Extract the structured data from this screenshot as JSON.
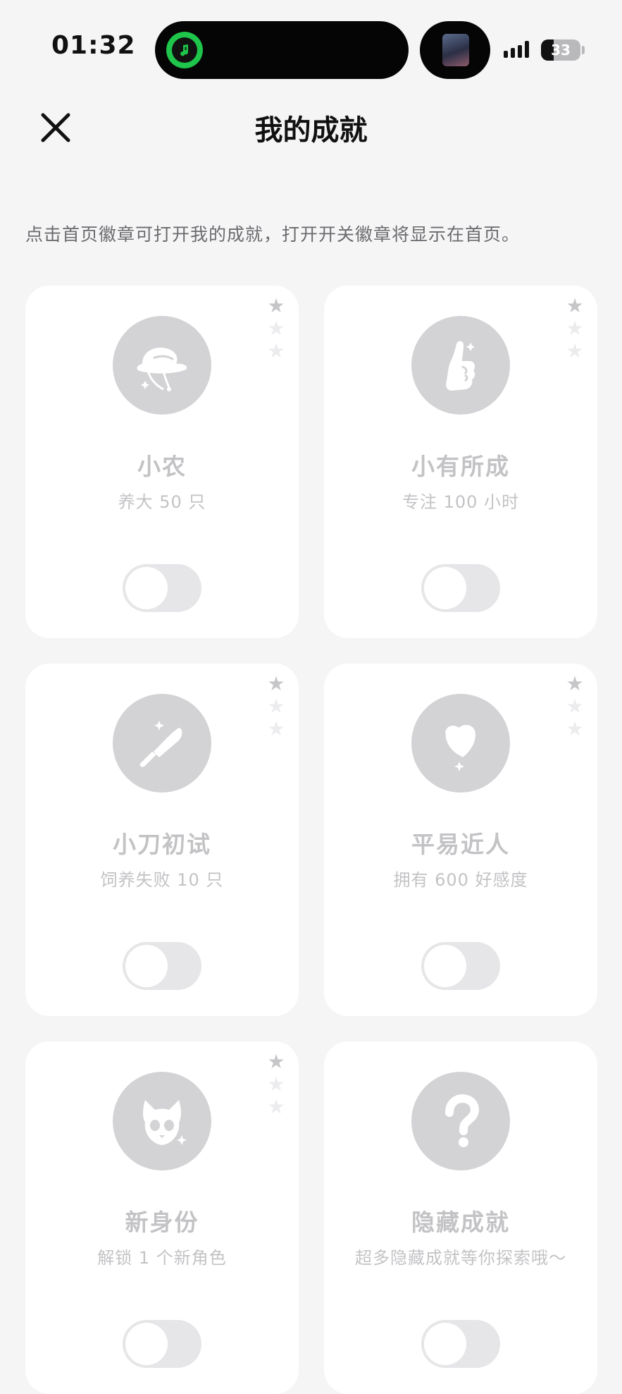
{
  "status_bar": {
    "time": "01:32",
    "battery": "33",
    "battery_level": 0.33
  },
  "header": {
    "title": "我的成就",
    "close_icon": "close-icon"
  },
  "intro": "点击首页徽章可打开我的成就，打开开关徽章将显示在首页。",
  "colors": {
    "background": "#f5f5f6",
    "card": "#ffffff",
    "badge": "#d3d3d5",
    "muted_text": "#c3c3c6",
    "toggle_off": "#e6e6e8"
  },
  "achievements": [
    {
      "title": "小农",
      "desc": "养大 50 只",
      "icon": "farmer-hat-icon",
      "stars_filled": 1,
      "stars_total": 3,
      "enabled": false
    },
    {
      "title": "小有所成",
      "desc": "专注 100 小时",
      "icon": "thumbs-up-icon",
      "stars_filled": 1,
      "stars_total": 3,
      "enabled": false
    },
    {
      "title": "小刀初试",
      "desc": "饲养失败 10 只",
      "icon": "knife-icon",
      "stars_filled": 1,
      "stars_total": 3,
      "enabled": false
    },
    {
      "title": "平易近人",
      "desc": "拥有 600 好感度",
      "icon": "heart-icon",
      "stars_filled": 1,
      "stars_total": 3,
      "enabled": false
    },
    {
      "title": "新身份",
      "desc": "解锁 1 个新角色",
      "icon": "cat-face-icon",
      "stars_filled": 1,
      "stars_total": 3,
      "enabled": false
    },
    {
      "title": "隐藏成就",
      "desc": "超多隐藏成就等你探索哦～",
      "icon": "question-mark-icon",
      "stars_filled": 0,
      "stars_total": 0,
      "enabled": false
    }
  ]
}
